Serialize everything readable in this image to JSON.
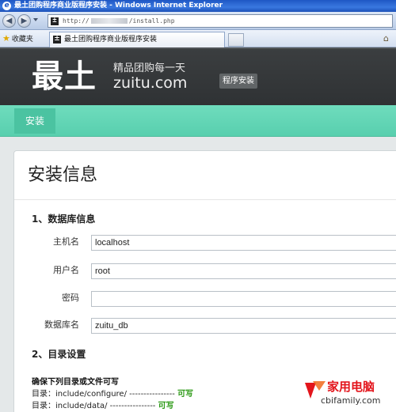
{
  "browser": {
    "window_title": "最土团购程序商业版程序安装 - Windows Internet Explorer",
    "url_prefix": "http://",
    "url_suffix": "/install.php",
    "favorites_label": "收藏夹",
    "tab_title": "最土团购程序商业版程序安装"
  },
  "header": {
    "logo": "最土",
    "slogan": "精品团购每一天",
    "domain": "zuitu.com",
    "badge": "程序安装"
  },
  "nav": {
    "active_tab": "安装"
  },
  "main": {
    "title": "安装信息",
    "db_section": "1、数据库信息",
    "fields": {
      "host": {
        "label": "主机名",
        "value": "localhost"
      },
      "user": {
        "label": "用户名",
        "value": "root"
      },
      "password": {
        "label": "密码",
        "value": ""
      },
      "dbname": {
        "label": "数据库名",
        "value": "zuitu_db"
      }
    },
    "dir_section": "2、目录设置",
    "dir_check_heading": "确保下列目录或文件可写",
    "dirs": [
      {
        "text": "目录：include/configure/ ----------------",
        "status": "可写"
      },
      {
        "text": "目录：include/data/ ----------------",
        "status": "可写"
      }
    ]
  },
  "watermark": {
    "cn": "家用电脑",
    "en": "cbifamily.com"
  },
  "colors": {
    "accent_green": "#58cfae",
    "header_dark": "#333638",
    "ok_green": "#2d9a17",
    "watermark_red": "#e3151c"
  }
}
